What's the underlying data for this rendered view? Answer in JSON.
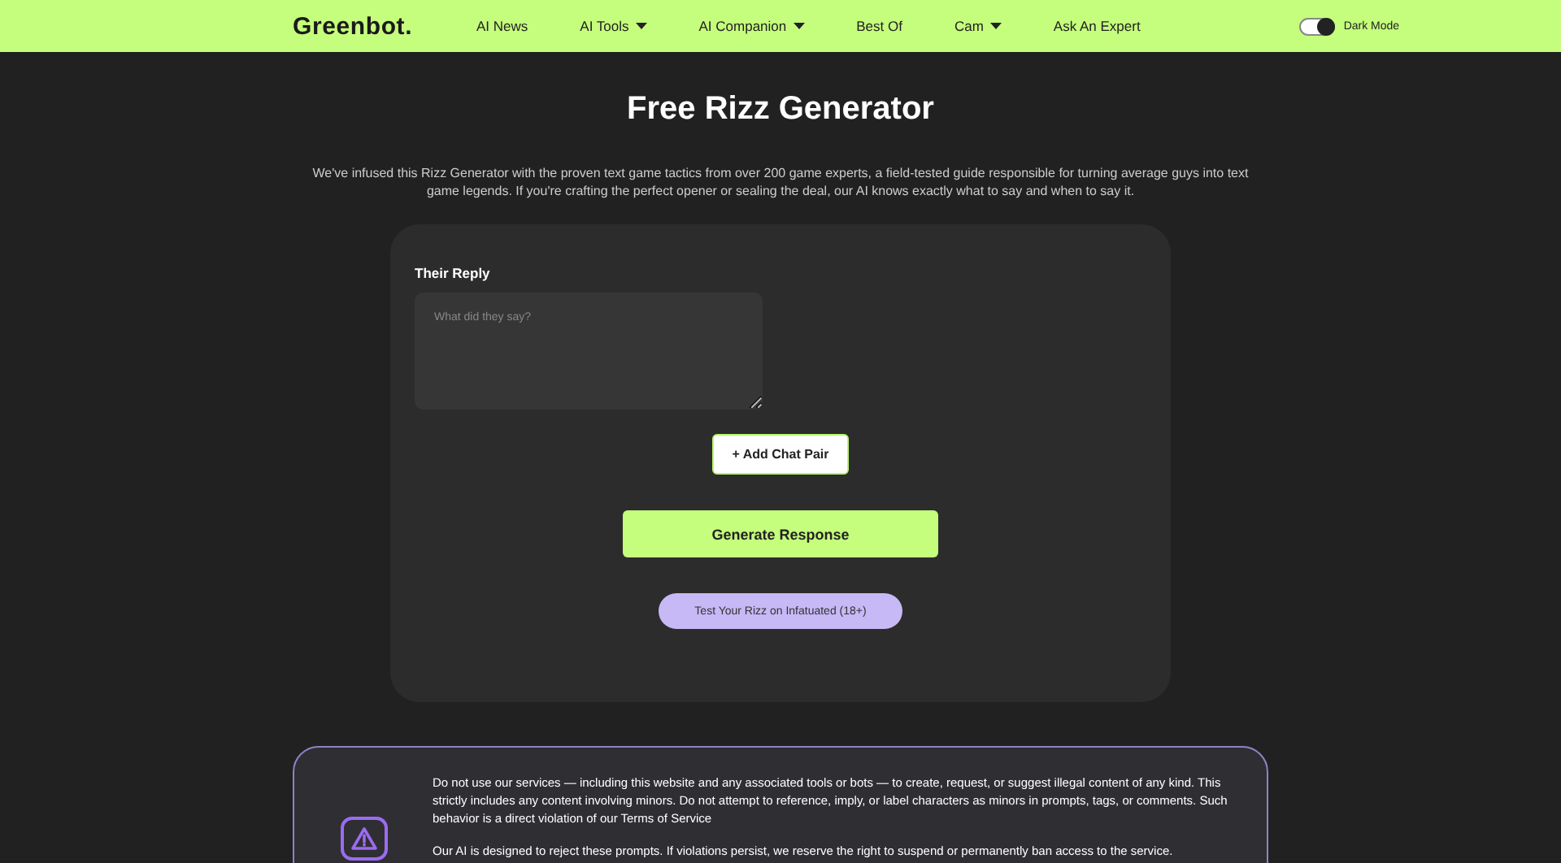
{
  "nav": {
    "logo": "Greenbot.",
    "items": [
      {
        "label": "AI News",
        "has_menu": false
      },
      {
        "label": "AI Tools",
        "has_menu": true
      },
      {
        "label": "AI Companion",
        "has_menu": true
      },
      {
        "label": "Best Of",
        "has_menu": false
      },
      {
        "label": "Cam",
        "has_menu": true
      },
      {
        "label": "Ask An Expert",
        "has_menu": false
      }
    ],
    "toggle": {
      "label": "Dark Mode",
      "on": true
    }
  },
  "title": "Free Rizz Generator",
  "intro": "We've infused this Rizz Generator with the proven text game tactics from over 200 game experts, a field-tested guide responsible for turning average guys into text game legends. If you're crafting the perfect opener or sealing the deal, our AI knows exactly what to say and when to say it.",
  "form": {
    "label": "Their Reply",
    "placeholder": "What did they say?",
    "add_button": "+ Add Chat Pair",
    "generate_button": "Generate Response",
    "test_button": "Test Your Rizz on Infatuated (18+)"
  },
  "notice": {
    "paragraphs": [
      "Do not use our services — including this website and any associated tools or bots — to create, request, or suggest illegal content of any kind. This strictly includes any content involving minors. Do not attempt to reference, imply, or label characters as minors in prompts, tags, or comments. Such behavior is a direct violation of our Terms of Service",
      "Our AI is designed to reject these prompts. If violations persist, we reserve the right to suspend or permanently ban access to the service."
    ]
  }
}
